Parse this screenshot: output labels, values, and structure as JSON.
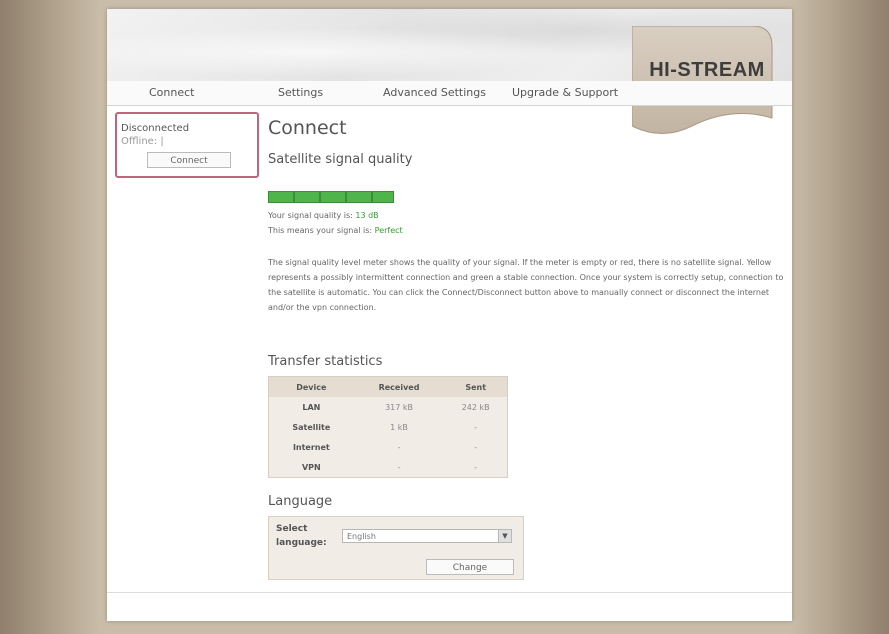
{
  "brand": {
    "logo_text": "HI-STREAM"
  },
  "nav": {
    "items": [
      {
        "label": "Connect"
      },
      {
        "label": "Settings"
      },
      {
        "label": "Advanced Settings"
      },
      {
        "label": "Upgrade & Support"
      }
    ]
  },
  "status": {
    "title": "Disconnected",
    "sub": "Offline: |",
    "button": "Connect"
  },
  "main": {
    "title": "Connect",
    "signal": {
      "heading": "Satellite signal quality",
      "quality_prefix": "Your signal quality is: ",
      "quality_value": "13 dB",
      "means_prefix": "This means your signal is: ",
      "means_value": "Perfect",
      "meter_level": 1.0
    },
    "description": "The signal quality level meter shows the quality of your signal. If the meter is empty or red, there is no satellite signal. Yellow represents a possibly intermittent connection and green a stable connection. Once your system is correctly setup, connection to the satellite is automatic. You can click the Connect/Disconnect button above to manually connect or disconnect the internet and/or the vpn connection.",
    "transfer": {
      "heading": "Transfer statistics",
      "columns": [
        "Device",
        "Received",
        "Sent"
      ],
      "rows": [
        [
          "LAN",
          "317 kB",
          "242 kB"
        ],
        [
          "Satellite",
          "1 kB",
          "-"
        ],
        [
          "Internet",
          "-",
          "-"
        ],
        [
          "VPN",
          "-",
          "-"
        ]
      ]
    },
    "language": {
      "heading": "Language",
      "label": "Select language:",
      "selected": "English",
      "button": "Change"
    }
  },
  "colors": {
    "signal_green": "#4fb44a",
    "status_border": "#c0657a"
  }
}
